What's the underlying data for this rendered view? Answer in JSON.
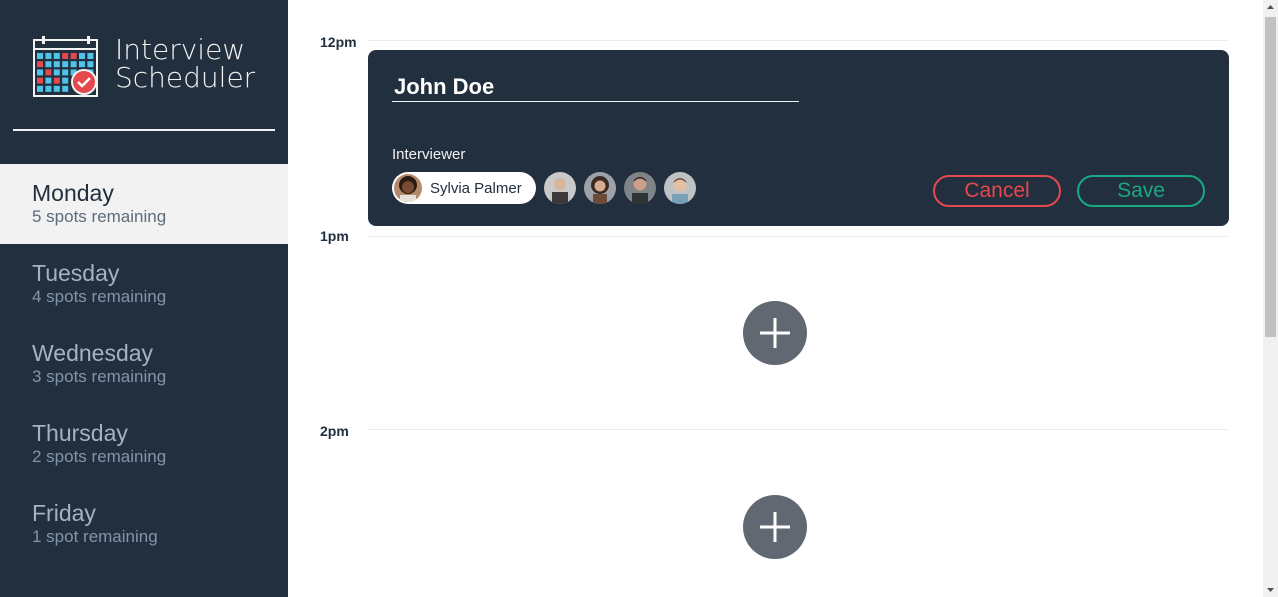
{
  "app": {
    "title_line1": "Interview",
    "title_line2": "Scheduler"
  },
  "days": [
    {
      "name": "Monday",
      "spots": "5 spots remaining",
      "selected": true
    },
    {
      "name": "Tuesday",
      "spots": "4 spots remaining",
      "selected": false
    },
    {
      "name": "Wednesday",
      "spots": "3 spots remaining",
      "selected": false
    },
    {
      "name": "Thursday",
      "spots": "2 spots remaining",
      "selected": false
    },
    {
      "name": "Friday",
      "spots": "1 spot remaining",
      "selected": false
    }
  ],
  "times": [
    "12pm",
    "1pm",
    "2pm"
  ],
  "form": {
    "student_name": "John Doe",
    "interviewer_label": "Interviewer",
    "selected_interviewer": "Sylvia Palmer",
    "cancel_label": "Cancel",
    "save_label": "Save"
  },
  "colors": {
    "sidebar": "#222f3e",
    "selected_day_bg": "#f2f2f2",
    "cancel": "#e5484d",
    "save": "#1aa882",
    "add_button": "#616872"
  },
  "icons": {
    "add": "plus-icon",
    "logo": "calendar-check-icon"
  }
}
